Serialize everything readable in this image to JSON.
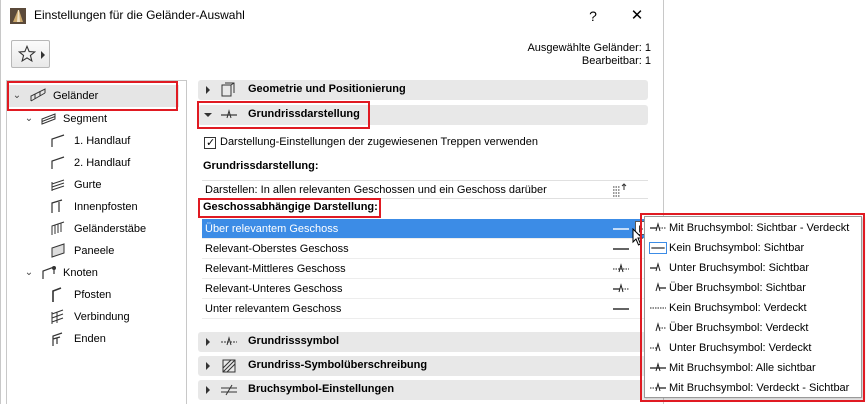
{
  "window": {
    "title": "Einstellungen für die Geländer-Auswahl",
    "help_label": "?",
    "close_label": "✕"
  },
  "selection_info": {
    "selected": "Ausgewählte Geländer: 1",
    "editable": "Bearbeitbar: 1"
  },
  "tree": {
    "items": [
      {
        "label": "Geländer",
        "icon": "railing-icon"
      },
      {
        "label": "Segment",
        "icon": "segment-icon"
      },
      {
        "label": "1. Handlauf",
        "icon": "handrail-icon"
      },
      {
        "label": "2. Handlauf",
        "icon": "handrail-icon"
      },
      {
        "label": "Gurte",
        "icon": "rail-icon"
      },
      {
        "label": "Innenpfosten",
        "icon": "inner-post-icon"
      },
      {
        "label": "Geländerstäbe",
        "icon": "baluster-icon"
      },
      {
        "label": "Paneele",
        "icon": "panel-icon"
      },
      {
        "label": "Knoten",
        "icon": "node-icon"
      },
      {
        "label": "Pfosten",
        "icon": "post-icon"
      },
      {
        "label": "Verbindung",
        "icon": "connection-icon"
      },
      {
        "label": "Enden",
        "icon": "end-icon"
      }
    ]
  },
  "sections": {
    "geometry": "Geometrie und Positionierung",
    "floorplan": "Grundrissdarstellung",
    "floorplan_symbol": "Grundrisssymbol",
    "symbol_override": "Grundriss-Symbolüberschreibung",
    "break_symbol": "Bruchsymbol-Einstellungen"
  },
  "floorplan": {
    "checkbox_label": "Darstellung-Einstellungen der zugewiesenen Treppen verwenden",
    "checkbox_checked": true,
    "subheading": "Grundrissdarstellung:",
    "show_on_label": "Darstellen: In allen relevanten Geschossen und ein Geschoss darüber",
    "story_heading": "Geschossabhängige Darstellung:",
    "story_rows": [
      "Über relevantem Geschoss",
      "Relevant-Oberstes Geschoss",
      "Relevant-Mittleres Geschoss",
      "Relevant-Unteres Geschoss",
      "Unter relevantem Geschoss"
    ]
  },
  "popup": {
    "items": [
      "Mit Bruchsymbol: Sichtbar - Verdeckt",
      "Kein Bruchsymbol: Sichtbar",
      "Unter Bruchsymbol: Sichtbar",
      "Über Bruchsymbol: Sichtbar",
      "Kein Bruchsymbol: Verdeckt",
      "Über Bruchsymbol: Verdeckt",
      "Unter Bruchsymbol: Verdeckt",
      "Mit Bruchsymbol: Alle sichtbar",
      "Mit Bruchsymbol: Verdeckt - Sichtbar"
    ]
  },
  "colors": {
    "selection_blue": "#3c8ce6",
    "highlight_red": "#e01a22",
    "section_gray": "#e8e8e8"
  }
}
